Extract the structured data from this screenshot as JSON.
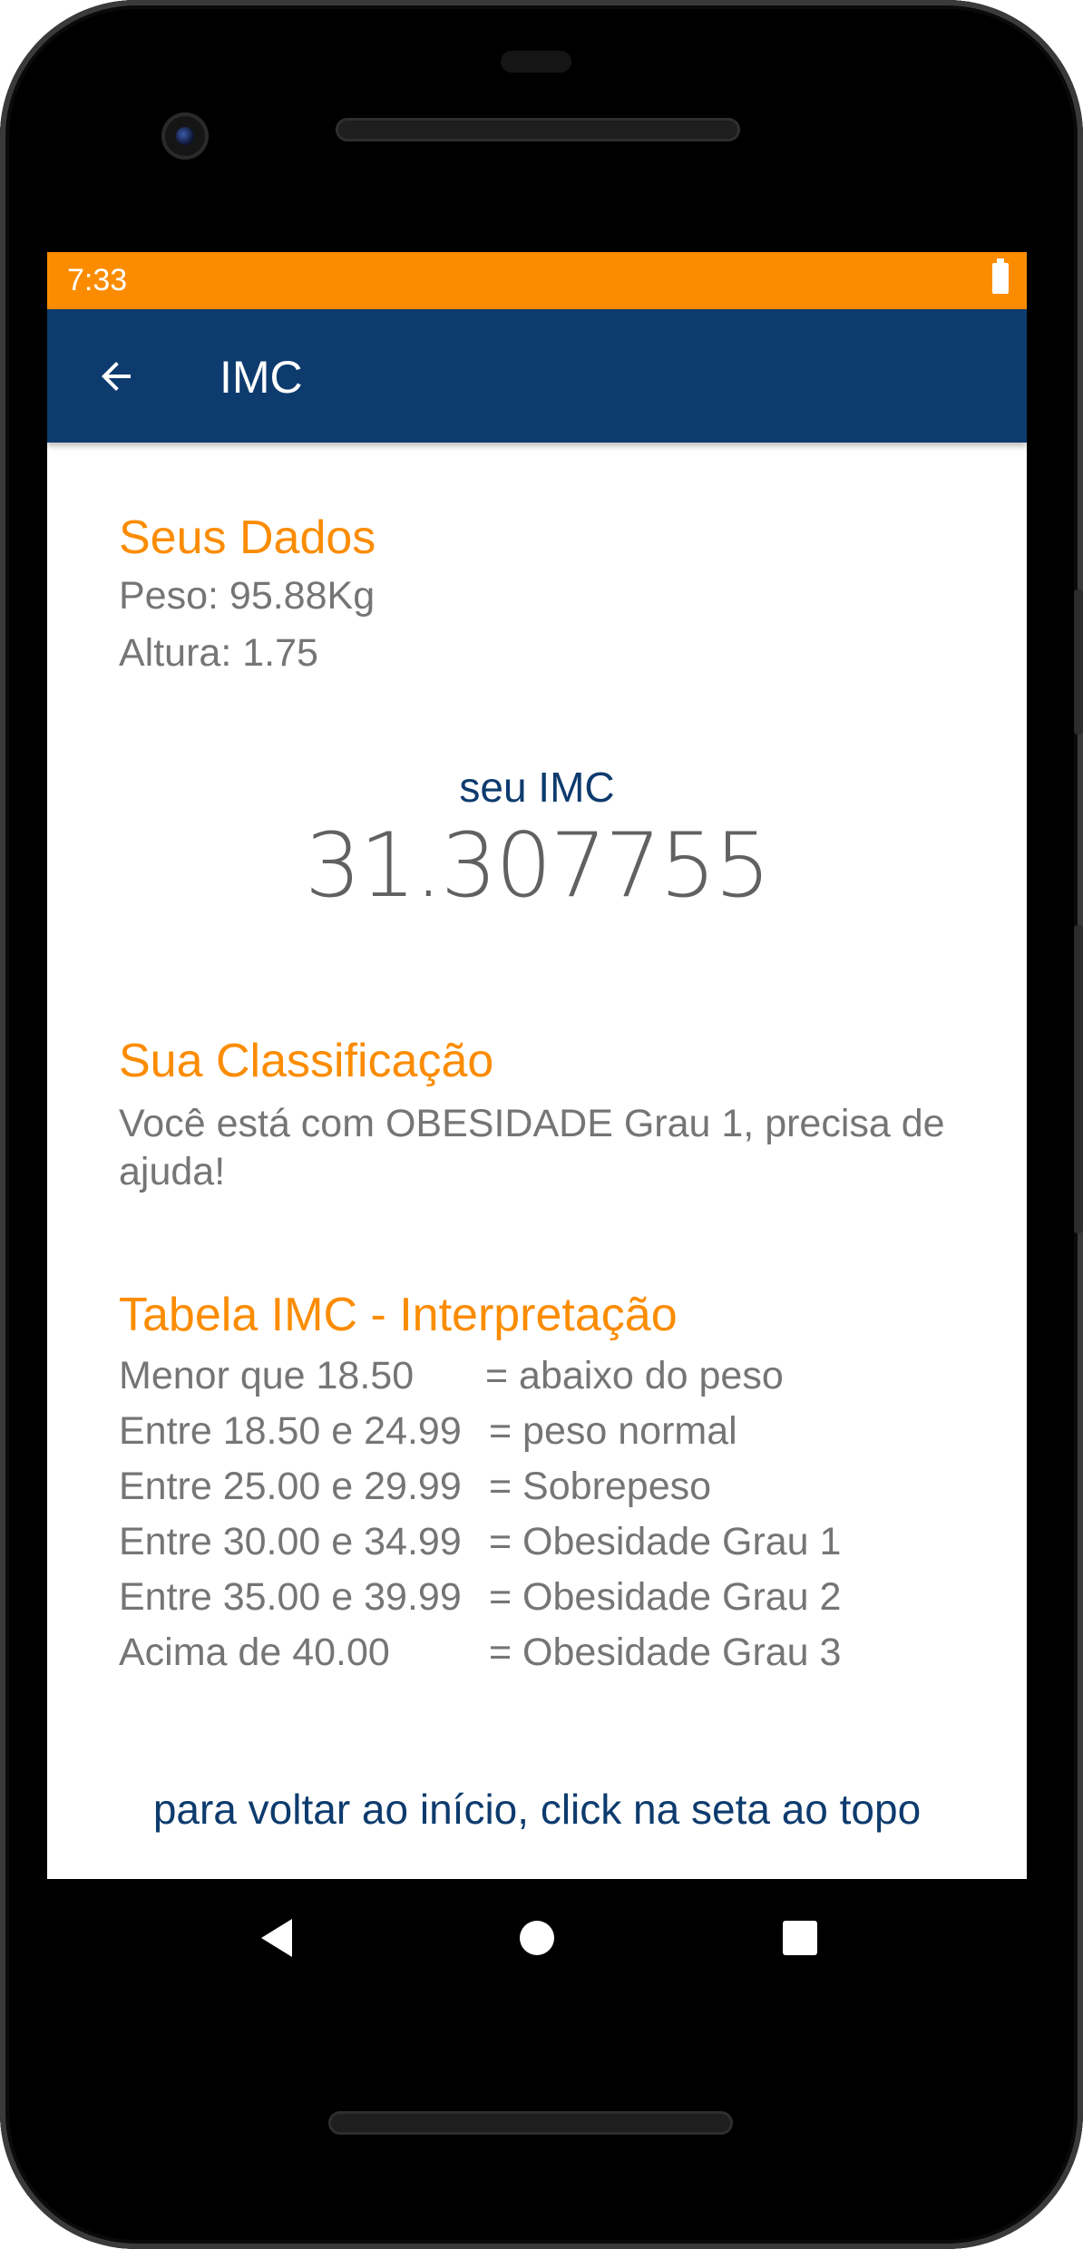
{
  "status_bar": {
    "time": "7:33",
    "battery_icon": "battery-full-icon"
  },
  "app_bar": {
    "title": "IMC",
    "back_icon": "arrow-back-icon"
  },
  "user_data": {
    "heading": "Seus Dados",
    "weight_text": "Peso:  95.88Kg",
    "height_text": "Altura: 1.75"
  },
  "imc": {
    "label": "seu IMC",
    "value": "31.307755"
  },
  "classification": {
    "heading": "Sua Classificação",
    "text": "Você está com OBESIDADE Grau 1, precisa de ajuda!"
  },
  "table": {
    "heading": "Tabela IMC - Interpretação",
    "rows": [
      {
        "range": "Menor que 18.50",
        "meaning": "= abaixo do peso"
      },
      {
        "range": "Entre 18.50 e 24.99",
        "meaning": "= peso normal"
      },
      {
        "range": "Entre 25.00 e 29.99",
        "meaning": "= Sobrepeso"
      },
      {
        "range": "Entre 30.00 e 34.99",
        "meaning": "= Obesidade Grau 1"
      },
      {
        "range": "Entre 35.00 e 39.99",
        "meaning": "= Obesidade Grau 2"
      },
      {
        "range": "Acima de 40.00",
        "meaning": "= Obesidade Grau 3"
      }
    ]
  },
  "footer": {
    "hint": "para voltar ao início, click na seta ao topo"
  },
  "nav_bar": {
    "back": "nav-back-icon",
    "home": "nav-home-icon",
    "recents": "nav-recents-icon"
  },
  "colors": {
    "accent": "#fb8c00",
    "primary": "#0d3b6e",
    "text": "#757575"
  }
}
